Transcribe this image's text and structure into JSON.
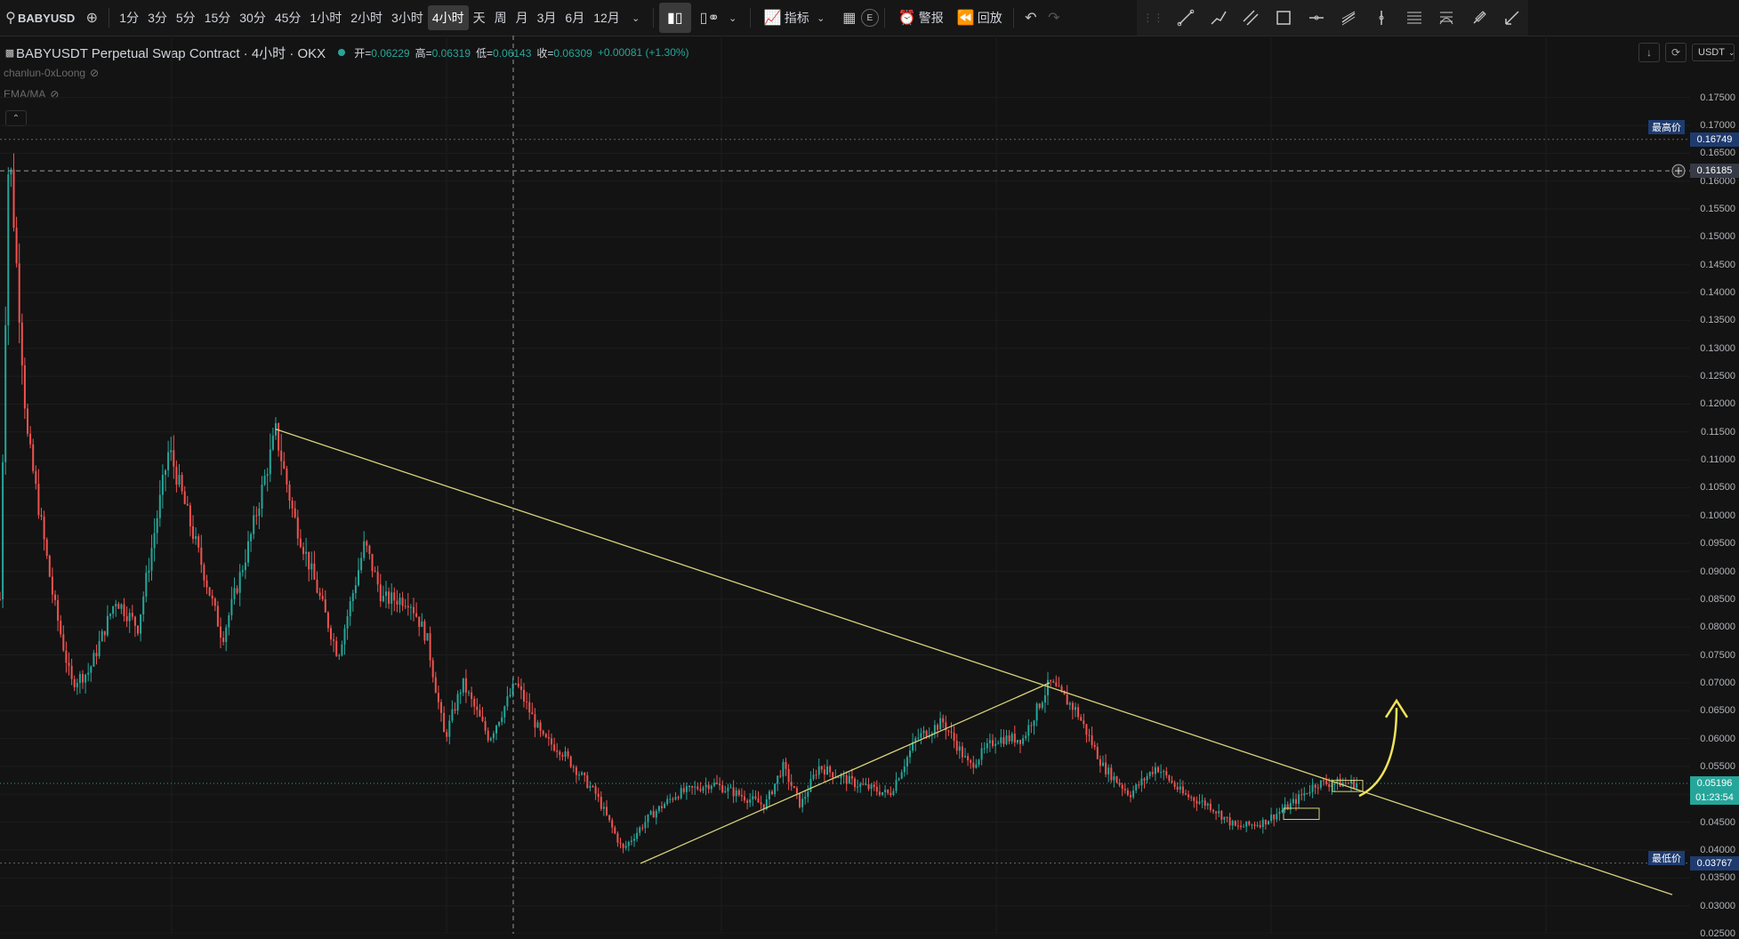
{
  "toolbar": {
    "symbol": "BABYUSD",
    "intervals": [
      "1分",
      "3分",
      "5分",
      "15分",
      "30分",
      "45分",
      "1小时",
      "2小时",
      "3小时",
      "4小时",
      "天",
      "周",
      "月",
      "3月",
      "6月",
      "12月"
    ],
    "active_interval": "4小时",
    "indicators_label": "指标",
    "alert_label": "警报",
    "replay_label": "回放",
    "e_badge": "E"
  },
  "legend": {
    "title": "BABYUSDT Perpetual Swap Contract · 4小时 · OKX",
    "open_label": "开=",
    "open": "0.06229",
    "high_label": "高=",
    "high": "0.06319",
    "low_label": "低=",
    "low": "0.06143",
    "close_label": "收=",
    "close": "0.06309",
    "change": "+0.00081 (+1.30%)",
    "indicator1": "chanlun-0xLoong",
    "indicator2": "EMA/MA"
  },
  "axis": {
    "currency": "USDT",
    "ticks": [
      "0.17500",
      "0.17000",
      "0.16500",
      "0.16000",
      "0.15500",
      "0.15000",
      "0.14500",
      "0.14000",
      "0.13500",
      "0.13000",
      "0.12500",
      "0.12000",
      "0.11500",
      "0.11000",
      "0.10500",
      "0.10000",
      "0.09500",
      "0.09000",
      "0.08500",
      "0.08000",
      "0.07500",
      "0.07000",
      "0.06500",
      "0.06000",
      "0.05500",
      "0.05000",
      "0.04500",
      "0.04000",
      "0.03500",
      "0.03000",
      "0.02500"
    ],
    "high_label": "最高价",
    "high_value": "0.16749",
    "low_label": "最低价",
    "low_value": "0.03767",
    "crosshair_value": "0.16185",
    "last_price": "0.05196",
    "countdown": "01:23:54"
  },
  "colors": {
    "up": "#26a69a",
    "down": "#ef5350",
    "trendline": "#d8d27a",
    "arrow": "#f2e35a",
    "last": "#26a69a",
    "tag": "#1f3b6e"
  },
  "chart_data": {
    "type": "candlestick",
    "title": "BABYUSDT Perpetual Swap Contract · 4小时 · OKX",
    "ylim": [
      0.025,
      0.1775
    ],
    "y_min_label": 0.03767,
    "y_max_label": 0.16749,
    "price_path": [
      [
        0,
        0.085
      ],
      [
        0.01,
        0.1675
      ],
      [
        0.03,
        0.115
      ],
      [
        0.06,
        0.085
      ],
      [
        0.08,
        0.07
      ],
      [
        0.1,
        0.072
      ],
      [
        0.13,
        0.085
      ],
      [
        0.155,
        0.08
      ],
      [
        0.19,
        0.112
      ],
      [
        0.22,
        0.095
      ],
      [
        0.25,
        0.078
      ],
      [
        0.28,
        0.095
      ],
      [
        0.31,
        0.115
      ],
      [
        0.33,
        0.1
      ],
      [
        0.36,
        0.085
      ],
      [
        0.38,
        0.075
      ],
      [
        0.41,
        0.095
      ],
      [
        0.43,
        0.085
      ],
      [
        0.46,
        0.085
      ],
      [
        0.48,
        0.078
      ],
      [
        0.5,
        0.06
      ],
      [
        0.52,
        0.07
      ],
      [
        0.55,
        0.06
      ],
      [
        0.58,
        0.07
      ],
      [
        0.61,
        0.06
      ],
      [
        0.63,
        0.058
      ],
      [
        0.67,
        0.05
      ],
      [
        0.7,
        0.04
      ],
      [
        0.73,
        0.046
      ],
      [
        0.76,
        0.05
      ],
      [
        0.8,
        0.052
      ],
      [
        0.83,
        0.05
      ],
      [
        0.86,
        0.048
      ],
      [
        0.88,
        0.055
      ],
      [
        0.9,
        0.048
      ],
      [
        0.92,
        0.055
      ],
      [
        0.96,
        0.052
      ],
      [
        1.0,
        0.05
      ],
      [
        1.03,
        0.06
      ],
      [
        1.06,
        0.063
      ],
      [
        1.09,
        0.055
      ],
      [
        1.12,
        0.06
      ],
      [
        1.15,
        0.06
      ],
      [
        1.18,
        0.07
      ],
      [
        1.21,
        0.065
      ],
      [
        1.24,
        0.055
      ],
      [
        1.27,
        0.05
      ],
      [
        1.3,
        0.055
      ],
      [
        1.33,
        0.05
      ],
      [
        1.36,
        0.048
      ],
      [
        1.39,
        0.044
      ],
      [
        1.42,
        0.045
      ],
      [
        1.45,
        0.048
      ],
      [
        1.48,
        0.052
      ]
    ],
    "trendlines": [
      {
        "from": [
          0.31,
          0.1155
        ],
        "to": [
          1.88,
          0.032
        ]
      },
      {
        "from": [
          0.72,
          0.0376
        ],
        "to": [
          1.18,
          0.07
        ]
      }
    ],
    "annotations": [
      "projected breakout arrow above descending trendline"
    ]
  }
}
